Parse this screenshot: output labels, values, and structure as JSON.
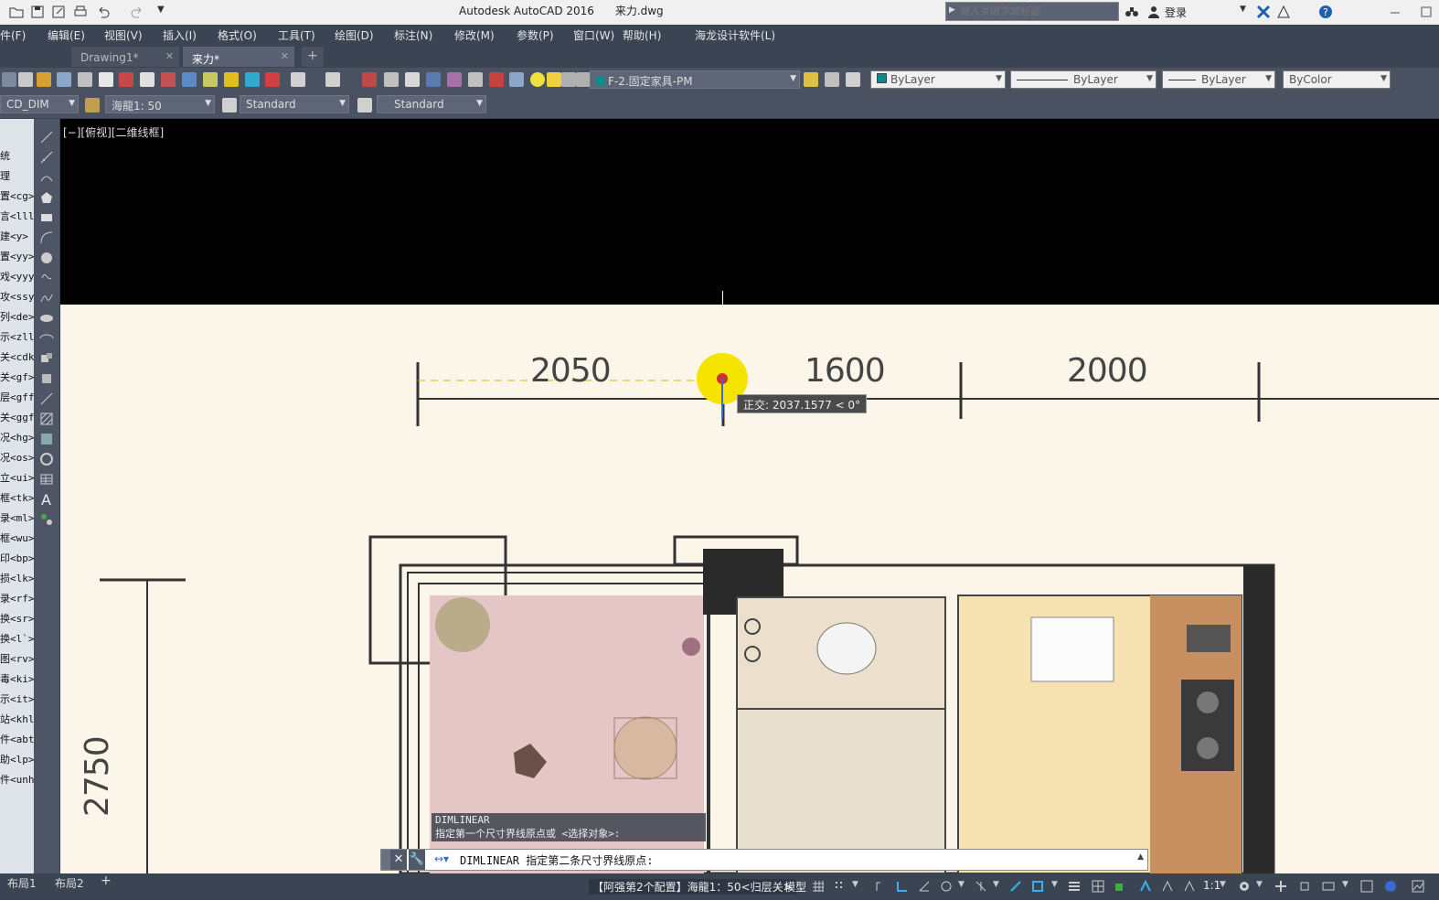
{
  "window": {
    "title": "Autodesk AutoCAD 2016",
    "filename": "来力.dwg",
    "search_placeholder": "键入关键字或短语",
    "login_label": "登录"
  },
  "menu": [
    "件(F)",
    "编辑(E)",
    "视图(V)",
    "插入(I)",
    "格式(O)",
    "工具(T)",
    "绘图(D)",
    "标注(N)",
    "修改(M)",
    "参数(P)",
    "窗口(W)",
    "帮助(H)",
    "海龙设计软件(L)"
  ],
  "tabs": [
    {
      "label": "Drawing1*"
    },
    {
      "label": "来力*"
    }
  ],
  "toolbar1": {
    "layer": "F-2.固定家具-PM",
    "color": "ByLayer",
    "linetype": "ByLayer",
    "lineweight": "ByLayer",
    "plotstyle": "ByColor"
  },
  "toolbar2": {
    "dimstyle": "CD_DIM",
    "scale": "海龍1: 50",
    "textstyle": "Standard",
    "tablestyle": "Standard"
  },
  "palette_items": [
    "统",
    "理",
    "置<cg>",
    "言<lll",
    "建<y>",
    "置<yy>",
    "戏<yyy",
    "攻<ssy",
    "列<de>",
    "示<zll",
    "关<cdk",
    "关<gf>",
    "层<gff",
    "关<ggf",
    "况<hg>",
    "况<os>",
    "立<ui>",
    "框<tk>",
    "录<ml>",
    "框<wu>",
    "印<bp>",
    "损<lk>",
    "录<rf>",
    "换<sr>",
    "换<l`>",
    "图<rv>",
    "毒<ki>",
    "示<it>",
    "站<khl",
    "件<abt",
    "助<lp>",
    "件<unh"
  ],
  "viewport_label": "[−][俯视][二维线框]",
  "dimensions": {
    "d1": "2050",
    "d2": "1600",
    "d3": "2000",
    "vertical": "2750"
  },
  "tooltip": "正交: 2037.1577 < 0°",
  "command_history": [
    "DIMLINEAR",
    "指定第一个尺寸界线原点或 <选择对象>:"
  ],
  "command_line": "DIMLINEAR 指定第二条尺寸界线原点:",
  "status": {
    "layouts": [
      "布局1",
      "布局2"
    ],
    "config": "【阿强第2个配置】海龍1：50<归层关>",
    "model": "模型",
    "scale": "1:1"
  },
  "colors": {
    "ui_dark": "#3b4453",
    "toolbar": "#4a5262",
    "paper": "#fbf5ea",
    "highlight": "#f5e400",
    "snap": "#d03030"
  }
}
